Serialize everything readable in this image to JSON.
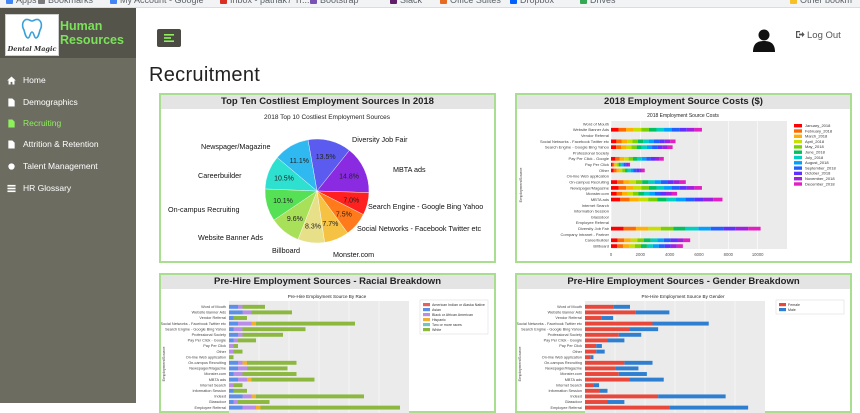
{
  "browser": {
    "bookmarks": [
      {
        "label": "Apps",
        "color": "#4285f4"
      },
      {
        "label": "Bookmarks",
        "color": "#7a7a7a"
      },
      {
        "label": "My Account - Google",
        "color": "#4285f4"
      },
      {
        "label": "Inbox - pathak7 Tr...",
        "color": "#d93025"
      },
      {
        "label": "Bootstrap",
        "color": "#7952b3"
      },
      {
        "label": "Slack",
        "color": "#611f69"
      },
      {
        "label": "Office Suites",
        "color": "#e66a1f"
      },
      {
        "label": "Dropbox",
        "color": "#0061ff"
      },
      {
        "label": "Drives",
        "color": "#34a853"
      },
      {
        "label": "Other bookm",
        "color": "#f6c026"
      }
    ]
  },
  "brand": {
    "title": "Human Resources",
    "logo_text": "Dental Magic",
    "accent": "#7be25a"
  },
  "sidebar": {
    "items": [
      {
        "label": "Home",
        "icon": "home-icon",
        "active": false
      },
      {
        "label": "Demographics",
        "icon": "file-icon",
        "active": false
      },
      {
        "label": "Recruiting",
        "icon": "file-icon",
        "active": true
      },
      {
        "label": "Attrition & Retention",
        "icon": "file-icon",
        "active": false
      },
      {
        "label": "Talent Management",
        "icon": "dot-icon",
        "active": false
      },
      {
        "label": "HR Glossary",
        "icon": "list-icon",
        "active": false
      }
    ]
  },
  "header": {
    "logout_label": "Log Out",
    "page_title": "Recruitment"
  },
  "panels": {
    "top10": {
      "title": "Top Ten Costliest Employment Sources In 2018"
    },
    "costs": {
      "title": "2018 Employment Source Costs ($)"
    },
    "race": {
      "title": "Pre-Hire Employment Sources - Racial Breakdown"
    },
    "gender": {
      "title": "Pre-Hire Employment Sources - Gender Breakdown"
    }
  },
  "chart_data": [
    {
      "type": "pie",
      "title": "2018 Top 10 Costliest Employment Sources",
      "slices": [
        {
          "label": "Diversity Job Fair",
          "value": 13.5,
          "color": "#5b5bf0"
        },
        {
          "label": "MBTA ads",
          "value": 14.8,
          "color": "#8a2be2"
        },
        {
          "label": "Search Engine - Google Bing Yahoo",
          "value": 7.0,
          "color": "#ff2020"
        },
        {
          "label": "Social Networks - Facebook Twitter etc",
          "value": 7.5,
          "color": "#ff7a1a"
        },
        {
          "label": "Monster.com",
          "value": 7.7,
          "color": "#f5c243"
        },
        {
          "label": "Billboard",
          "value": 8.3,
          "color": "#e8e089"
        },
        {
          "label": "Website Banner Ads",
          "value": 9.6,
          "color": "#a8e05a"
        },
        {
          "label": "On-campus Recruiting",
          "value": 10.1,
          "color": "#55e055"
        },
        {
          "label": "Careerbuilder",
          "value": 10.5,
          "color": "#2ee0d0"
        },
        {
          "label": "Newspager/Magazine",
          "value": 11.1,
          "color": "#30b8f0"
        }
      ]
    },
    {
      "type": "bar",
      "orientation": "horizontal-stacked",
      "title": "2018 Employment Source Costs",
      "ylabel": "EmploymentSource",
      "xlim": [
        0,
        12000
      ],
      "x_ticks": [
        0,
        2000,
        4000,
        6000,
        8000,
        10000
      ],
      "legend": "right",
      "months": [
        "January_2018",
        "February_2018",
        "March_2018",
        "April_2018",
        "May_2018",
        "June_2018",
        "July_2018",
        "August_2018",
        "September_2018",
        "October_2018",
        "November_2018",
        "December_2018"
      ],
      "month_colors": [
        "#ff0000",
        "#ff6a00",
        "#ffb000",
        "#c8e000",
        "#7ad000",
        "#00c060",
        "#00d0c0",
        "#00a0ff",
        "#2060ff",
        "#6030ff",
        "#a020e0",
        "#e020c0"
      ],
      "categories": [
        "Word of Mouth",
        "Website Banner Ads",
        "Vendor Referral",
        "Social Networks - Facebook Twitter etc",
        "Search Engine - Google Bing Yahoo",
        "Professional Society",
        "Pay Per Click - Google",
        "Pay Per Click",
        "Other",
        "On-line Web application",
        "On-campus Recruiting",
        "Newspager/Magazine",
        "Monster.com",
        "MBTA ads",
        "Internet Search",
        "Information Session",
        "Glassdoor",
        "Employee Referral",
        "Diversity Job Fair",
        "Company Intranet - Partner",
        "Careerbuilder",
        "Billboard"
      ],
      "totals": [
        0,
        6200,
        0,
        4400,
        4200,
        0,
        3600,
        1300,
        2300,
        0,
        5100,
        6200,
        4500,
        7600,
        0,
        0,
        0,
        0,
        10200,
        0,
        5400,
        4900
      ]
    },
    {
      "type": "bar",
      "orientation": "horizontal-stacked",
      "title": "Pre-Hire Employment Source By Race",
      "ylabel": "EmploymentSource",
      "legend": "top-right",
      "series_names": [
        "American Indian or Alaska Native",
        "Asian",
        "Black or African American",
        "Hispanic",
        "Two or more races",
        "White"
      ],
      "series_colors": [
        "#e8605a",
        "#5b8fe8",
        "#b98ee8",
        "#f0b030",
        "#6fc6c0",
        "#8cb840"
      ],
      "categories": [
        "Word of Mouth",
        "Website Banner Ads",
        "Vendor Referral",
        "Social Networks - Facebook Twitter etc",
        "Search Engine - Google Bing Yahoo",
        "Professional Society",
        "Pay Per Click - Google",
        "Pay Per Click",
        "Other",
        "On-line Web application",
        "On-campus Recruiting",
        "Newspager/Magazine",
        "Monster.com",
        "MBTA ads",
        "Internet Search",
        "Information Session",
        "Indeed",
        "Glassdoor",
        "Employee Referral"
      ],
      "values": [
        [
          0,
          2,
          1,
          0,
          0,
          5
        ],
        [
          0,
          3,
          2,
          0,
          0,
          9
        ],
        [
          0,
          1,
          0,
          0,
          0,
          3
        ],
        [
          0,
          2,
          3,
          1,
          0,
          22
        ],
        [
          0,
          1,
          2,
          0,
          0,
          14
        ],
        [
          0,
          2,
          1,
          0,
          0,
          9
        ],
        [
          0,
          1,
          1,
          0,
          0,
          4
        ],
        [
          0,
          0,
          1,
          0,
          0,
          1
        ],
        [
          0,
          0,
          1,
          0,
          0,
          2
        ],
        [
          0,
          0,
          0,
          0,
          0,
          1
        ],
        [
          0,
          2,
          1,
          1,
          0,
          11
        ],
        [
          0,
          2,
          2,
          0,
          0,
          9
        ],
        [
          0,
          1,
          2,
          0,
          0,
          12
        ],
        [
          0,
          2,
          2,
          1,
          0,
          14
        ],
        [
          0,
          0,
          1,
          0,
          0,
          2
        ],
        [
          0,
          1,
          0,
          0,
          0,
          3
        ],
        [
          0,
          3,
          2,
          1,
          0,
          24
        ],
        [
          0,
          1,
          1,
          0,
          0,
          7
        ],
        [
          0,
          3,
          3,
          1,
          0,
          31
        ]
      ]
    },
    {
      "type": "bar",
      "orientation": "horizontal-stacked",
      "title": "Pre-Hire Employment Source By Gender",
      "ylabel": "EmploymentSource",
      "legend": "top-right",
      "series_names": [
        "Female",
        "Male"
      ],
      "series_colors": [
        "#e8483c",
        "#2f7fd0"
      ],
      "categories": [
        "Word of Mouth",
        "Website Banner Ads",
        "Vendor Referral",
        "Social Networks - Facebook Twitter etc",
        "Search Engine - Google Bing Yahoo",
        "Professional Society",
        "Pay Per Click - Google",
        "Pay Per Click",
        "Other",
        "On-line Web application",
        "On-campus Recruiting",
        "Newspager/Magazine",
        "Monster.com",
        "MBTA ads",
        "Internet Search",
        "Information Session",
        "Indeed",
        "Glassdoor",
        "Employee Referral"
      ],
      "values": [
        [
          10,
          6
        ],
        [
          18,
          12
        ],
        [
          6,
          4
        ],
        [
          24,
          20
        ],
        [
          16,
          10
        ],
        [
          12,
          8
        ],
        [
          8,
          6
        ],
        [
          4,
          2
        ],
        [
          4,
          3
        ],
        [
          2,
          1
        ],
        [
          14,
          10
        ],
        [
          11,
          8
        ],
        [
          12,
          10
        ],
        [
          16,
          12
        ],
        [
          3,
          2
        ],
        [
          5,
          3
        ],
        [
          26,
          24
        ],
        [
          8,
          6
        ],
        [
          30,
          28
        ]
      ]
    }
  ]
}
